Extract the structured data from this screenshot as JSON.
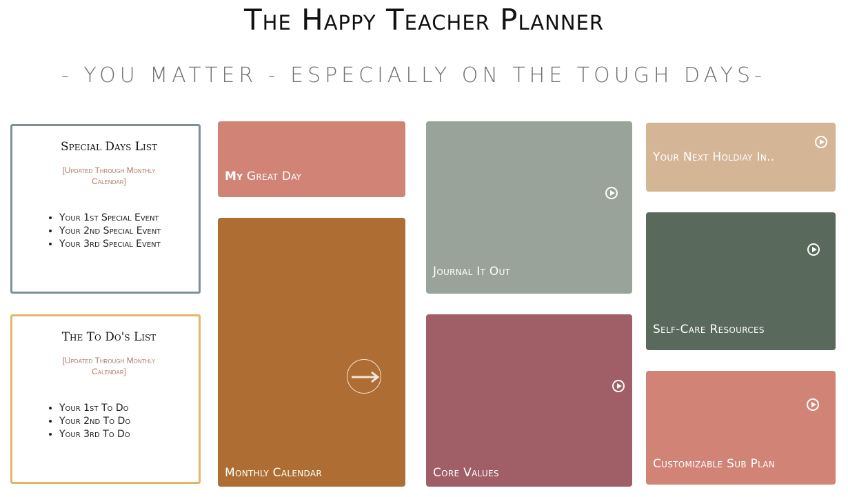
{
  "header": {
    "title": "The Happy Teacher Planner",
    "tagline": "- YOU MATTER - ESPECIALLY ON THE TOUGH DAYS-"
  },
  "special_days": {
    "title": "Special Days List",
    "note": "[Updated Through Monthly Calendar]",
    "items": [
      "Your 1st Special Event",
      "Your 2nd Special Event",
      "Your 3rd Special Event"
    ],
    "border_color": "#7e8f97"
  },
  "todo": {
    "title": "The To Do's List",
    "note": "[Updated Through Monthly Calendar]",
    "items": [
      "Your 1st To Do",
      "Your 2nd To Do",
      "Your 3rd To Do"
    ],
    "border_color": "#e3b56a"
  },
  "tiles": {
    "my_great_day": {
      "label_bold": "My",
      "label_rest": " Great Day",
      "color": "#d18476"
    },
    "monthly_calendar": {
      "label": "Monthly Calendar",
      "color": "#ae6e33",
      "icon": "arrow-right-icon"
    },
    "journal": {
      "label": "Journal It Out",
      "color": "#9aa399",
      "icon": "play-icon"
    },
    "core_values": {
      "label": "Core Values",
      "color": "#a05e66",
      "icon": "play-icon"
    },
    "next_holiday": {
      "label": "Your Next Holdiay In..",
      "color": "#d4b595",
      "icon": "play-icon"
    },
    "self_care": {
      "label": "Self-Care Resources",
      "color": "#59695b",
      "icon": "play-icon"
    },
    "sub_plan": {
      "label": "Customizable Sub Plan",
      "color": "#d18476",
      "icon": "play-icon"
    }
  }
}
